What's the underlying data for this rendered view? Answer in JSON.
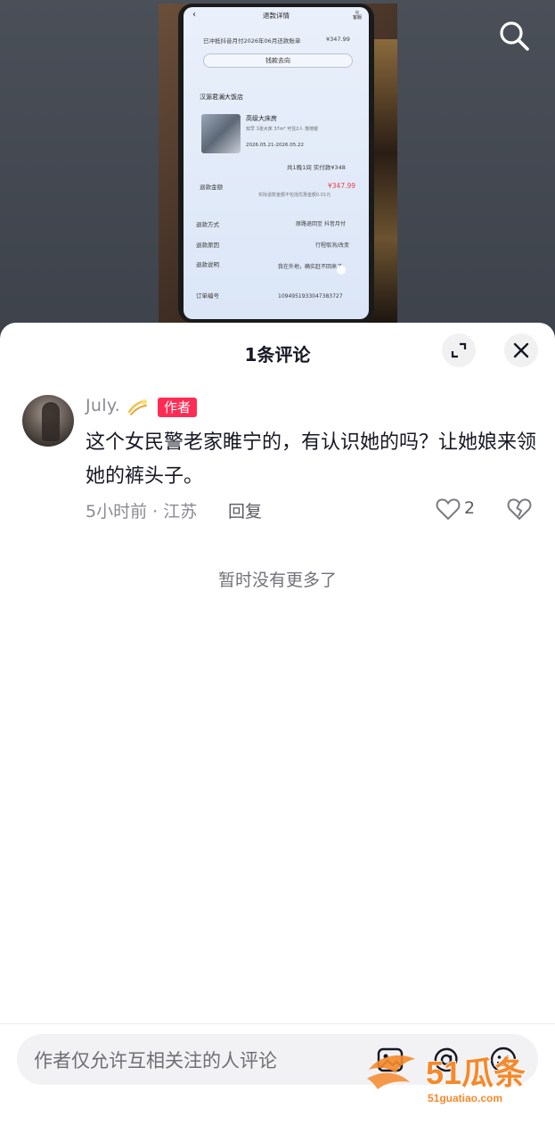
{
  "video": {
    "screen_title": "退款详情",
    "customer_service": "客服",
    "refund_status": "已冲抵抖音月付2026年06月还款账单",
    "refund_amount_top": "¥347.99",
    "money_flow_button": "钱款去向",
    "hotel_name": "汉源君澜大饭店",
    "room_type": "高级大床房",
    "room_detail": "双早 1张大床 37m² 可住2人 落地窗",
    "stay_dates": "2026.05.21-2026.05.22",
    "stay_summary": "共1晚1间  实付款¥348",
    "refund_label": "退款金额",
    "refund_value": "¥347.99",
    "refund_note": "实际退款金额不包括优惠金额0.01元",
    "method_label": "退款方式",
    "method_value": "原路退回至 抖音月付",
    "reason_label": "退款原因",
    "reason_value": "行程取消/改变",
    "explain_label": "退款说明",
    "explain_value": "我在外地，确实赶不回来了",
    "order_label": "订单编号",
    "order_value": "1094951933047383727"
  },
  "sheet": {
    "title": "1条评论",
    "expand_icon": "expand-icon",
    "close_icon": "close-icon"
  },
  "comment": {
    "username": "July.",
    "badge": "作者",
    "text": "这个女民警老家睢宁的，有认识她的吗？让她娘来领她的裤头子。",
    "meta": "5小时前 · 江苏",
    "reply_label": "回复",
    "like_count": "2"
  },
  "footer": {
    "no_more": "暂时没有更多了",
    "input_placeholder": "作者仅允许互相关注的人评论"
  },
  "watermark": {
    "brand": "51瓜条",
    "site": "51guatiao.com"
  },
  "colors": {
    "accent": "#fe2c55",
    "text_primary": "#161823",
    "text_secondary": "#8a8b91",
    "watermark_orange": "#f5892b"
  }
}
